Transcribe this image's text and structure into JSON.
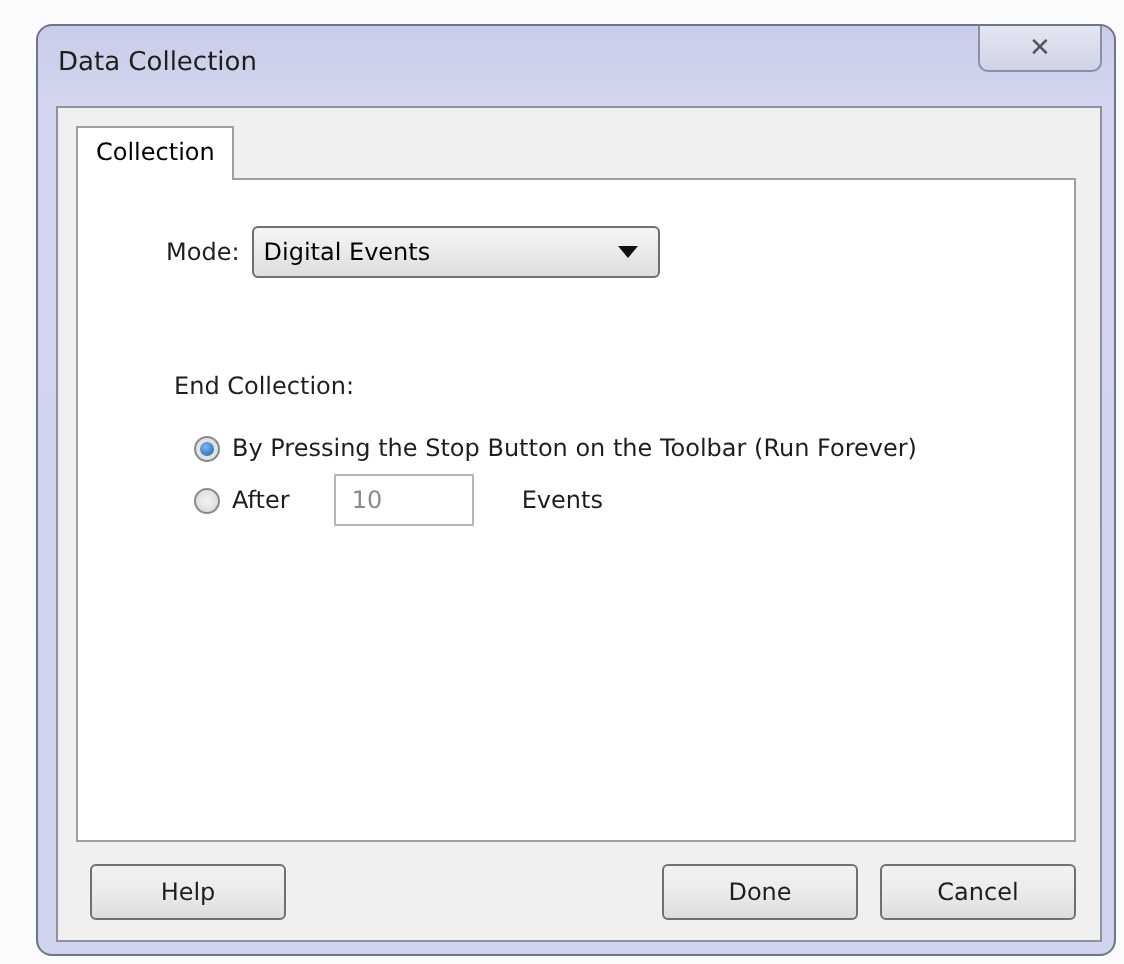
{
  "window": {
    "title": "Data Collection",
    "close": "✕"
  },
  "tabs": [
    {
      "label": "Collection",
      "selected": true
    }
  ],
  "mode": {
    "label": "Mode:",
    "value": "Digital Events"
  },
  "end_collection": {
    "label": "End Collection:",
    "options": [
      {
        "kind": "plain",
        "label": "By Pressing the Stop Button on the Toolbar (Run Forever)",
        "selected": true
      },
      {
        "kind": "count",
        "label": "After",
        "value": "10",
        "unit": "Events",
        "selected": false
      }
    ]
  },
  "buttons": [
    {
      "label": "Help",
      "kind": "left"
    },
    {
      "label": "Done",
      "kind": "right"
    },
    {
      "label": "Cancel",
      "kind": "right"
    }
  ]
}
